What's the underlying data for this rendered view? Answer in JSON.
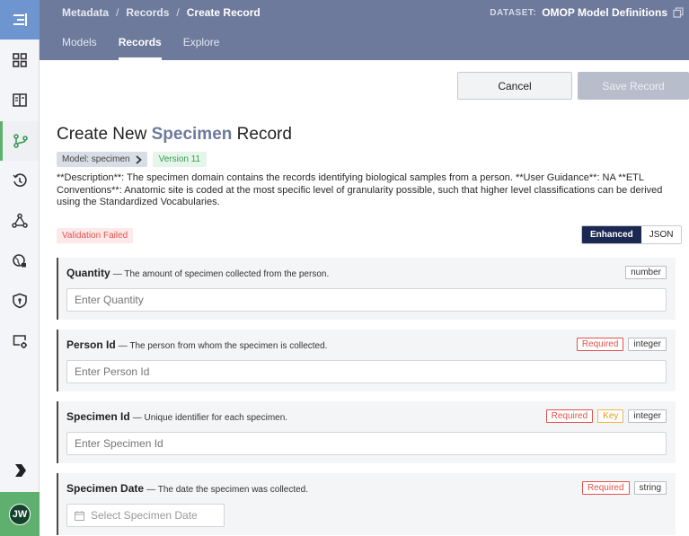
{
  "breadcrumb": [
    "Metadata",
    "Records",
    "Create Record"
  ],
  "dataset": {
    "label": "DATASET:",
    "name": "OMOP Model Definitions"
  },
  "tabs": [
    "Models",
    "Records",
    "Explore"
  ],
  "active_tab": "Records",
  "actions": {
    "cancel": "Cancel",
    "save": "Save Record"
  },
  "page": {
    "title_prefix": "Create New",
    "model_name": "Specimen",
    "title_suffix": "Record",
    "model_pill": "Model: specimen",
    "version_pill": "Version 11",
    "description": "**Description**: The specimen domain contains the records identifying biological samples from a person. **User Guidance**: NA **ETL Conventions**: Anatomic site is coded at the most specific level of granularity possible, such that higher level classifications can be derived using the Standardized Vocabularies.",
    "validation": "Validation Failed",
    "mode": {
      "enhanced": "Enhanced",
      "json": "JSON",
      "active": "Enhanced"
    }
  },
  "fields": [
    {
      "name": "Quantity",
      "desc": "— The amount of specimen collected from the person.",
      "required": "",
      "key": "",
      "type": "number",
      "placeholder": "Enter Quantity"
    },
    {
      "name": "Person Id",
      "desc": "— The person from whom the specimen is collected.",
      "required": "Required",
      "key": "",
      "type": "integer",
      "placeholder": "Enter Person Id"
    },
    {
      "name": "Specimen Id",
      "desc": "— Unique identifier for each specimen.",
      "required": "Required",
      "key": "Key",
      "type": "integer",
      "placeholder": "Enter Specimen Id"
    },
    {
      "name": "Specimen Date",
      "desc": "— The date the specimen was collected.",
      "required": "Required",
      "key": "",
      "type": "string",
      "placeholder": "Select Specimen Date"
    }
  ],
  "user": {
    "initials": "JW"
  },
  "colors": {
    "header": "#6e7a9c",
    "accent_green": "#5fb06e",
    "required_red": "#e0534f",
    "key_orange": "#e39a1e",
    "toggle_active": "#1b2851"
  }
}
